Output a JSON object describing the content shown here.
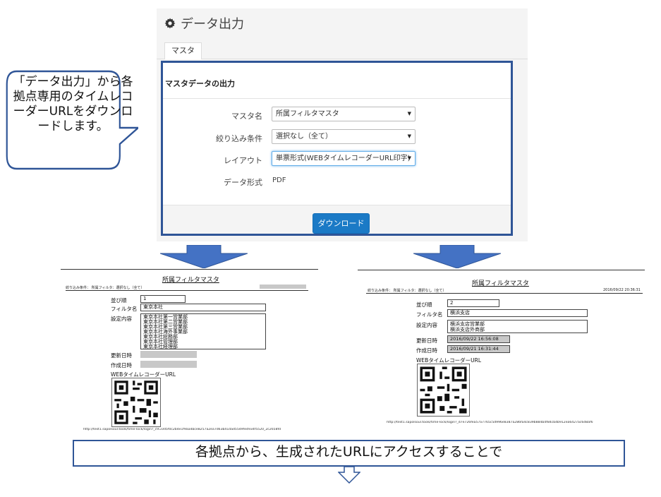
{
  "app": {
    "title": "データ出力",
    "tabs": [
      {
        "label": "マスタ"
      }
    ],
    "section_title": "マスタデータの出力",
    "form": {
      "master_name": {
        "label": "マスタ名",
        "value": "所属フィルタマスタ"
      },
      "filter": {
        "label": "絞り込み条件",
        "value": "選択なし（全て）"
      },
      "layout": {
        "label": "レイアウト",
        "value": "単票形式(WEBタイムレコーダーURL印字)"
      },
      "format": {
        "label": "データ形式",
        "value": "PDF"
      }
    },
    "download_label": "ダウンロード"
  },
  "callout": {
    "text": "「データ出力」から各拠点専用のタイムレコーダーURLをダウンロードします。"
  },
  "docs": [
    {
      "title": "所属フィルタマスタ",
      "filter_line": "絞り込み条件： 所属フィルタ：選択なし（全て）",
      "labels": {
        "order": "並び順",
        "filter_name": "フィルタ名",
        "settings": "設定内容",
        "updated": "更新日時",
        "created": "作成日時",
        "url_label": "WEBタイムレコーダーURL"
      },
      "order": "1",
      "filter_name": "東京本社",
      "settings": [
        "東京本社第一営業部",
        "東京本社第二営業部",
        "東京本社第三営業部",
        "東京本社海外事業部",
        "東京本社総務部",
        "東京本社管理部",
        "東京本社経理部"
      ],
      "url": "http://test1.sapolsoul.tools/time-lock/login?_c9=0d5f0c2b4e1f9aa4bce8257a2ea7d63b41dad5549fe4934f5520_2c2658fd"
    },
    {
      "title": "所属フィルタマスタ",
      "filter_line": "絞り込み条件： 所属フィルタ：選択なし（全て）",
      "date": "2016/09/22 20:36:31",
      "labels": {
        "order": "並び順",
        "filter_name": "フィルタ名",
        "settings": "設定内容",
        "updated": "更新日時",
        "created": "作成日時",
        "url_label": "WEBタイムレコーダーURL"
      },
      "order": "2",
      "filter_name": "横浜支店",
      "settings": [
        "横浜支店営業部",
        "横浜支店外商部"
      ],
      "updated": "2016/09/22 16:56:08",
      "created": "2016/09/21 16:31:44",
      "url": "http://test1.sapolsoul.tools/time-lock/login?_d7e726fea57a7765c5d996e8387a286fa4c839b884b4f84cb4b912ea6427ac6d8af6"
    }
  ],
  "banner": {
    "text": "各拠点から、生成されたURLにアクセスすることで"
  },
  "colors": {
    "frame_blue": "#2f5597",
    "arrow_blue": "#4472c4",
    "button_blue": "#1b7ac6"
  }
}
